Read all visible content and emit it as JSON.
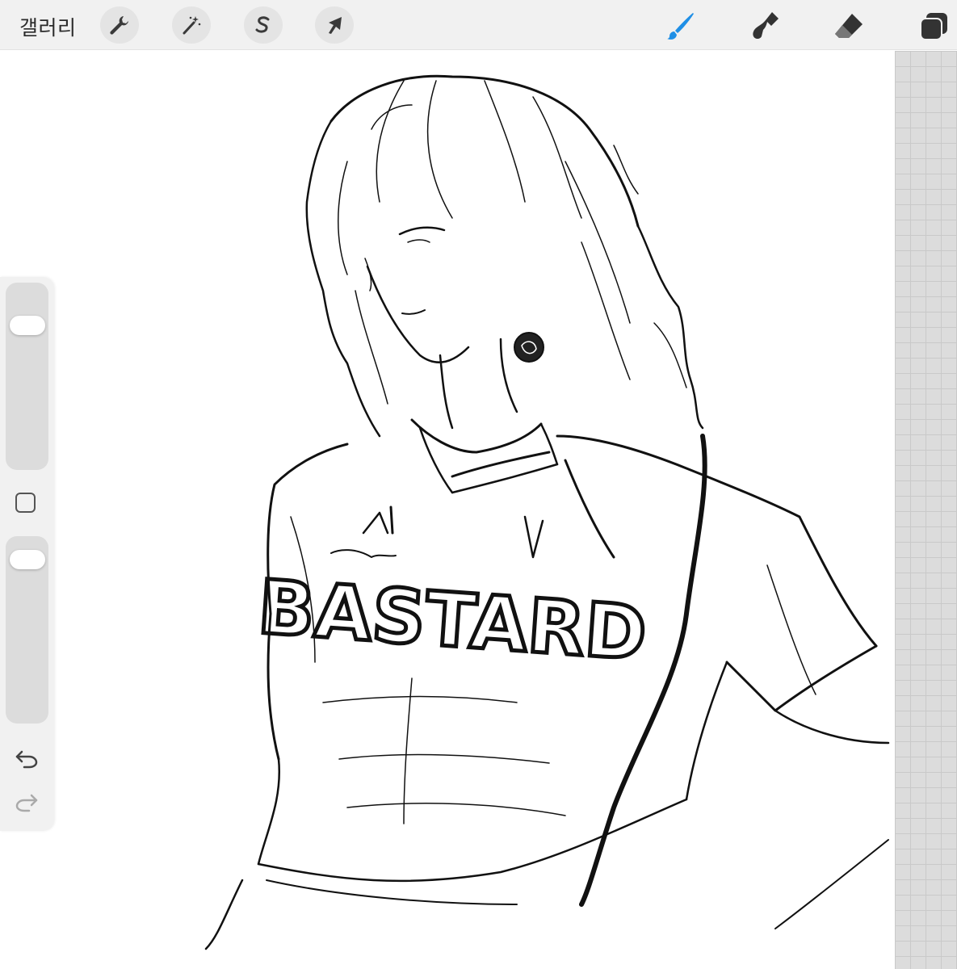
{
  "topbar": {
    "gallery_label": "갤러리",
    "action_icons": [
      "wrench-icon",
      "magic-wand-icon",
      "selection-icon",
      "transform-arrow-icon"
    ],
    "tool_icons": [
      "brush-icon",
      "smudge-icon",
      "eraser-icon",
      "layers-icon"
    ],
    "active_tool": "brush",
    "accent_color": "#1f8fe6"
  },
  "canvas": {
    "jersey_text": "BASTARD",
    "background": "#ffffff"
  },
  "sidebar": {
    "size_slider_level": 0.82,
    "opacity_slider_level": 0.94,
    "icons": [
      "modify-square-icon",
      "undo-icon",
      "redo-icon"
    ]
  }
}
